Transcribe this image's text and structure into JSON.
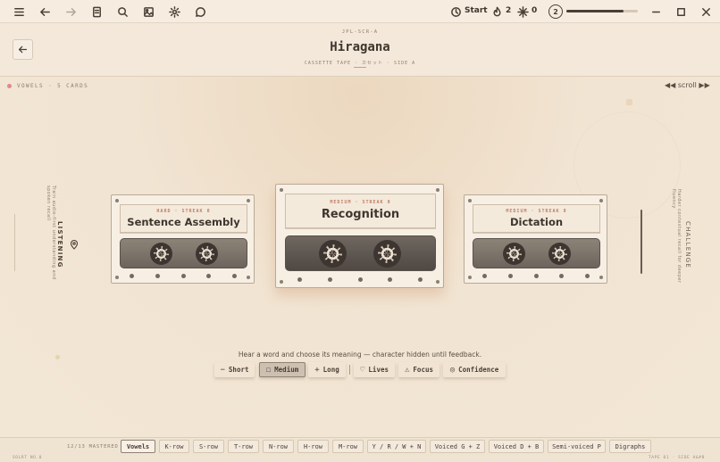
{
  "topbar": {
    "icons": [
      "menu-icon",
      "back-arrow-icon",
      "forward-arrow-icon",
      "notebook-icon",
      "search-icon",
      "image-icon",
      "gear-icon",
      "chat-icon"
    ],
    "start_label": "Start",
    "streak_count": "2",
    "gems_count": "0",
    "level_badge": "2",
    "progress": 0.8,
    "window_controls": [
      "minimize-icon",
      "maximize-icon",
      "close-icon"
    ]
  },
  "header": {
    "kicker": "JPL-SCR-A",
    "title": "Hiragana",
    "subtitle": "CASSETTE TAPE · カセット · SIDE A"
  },
  "stage": {
    "deck_label": "VOWELS · 5 CARDS",
    "scroll_label": "◀◀ scroll ▶▶",
    "left_side": {
      "title": "LISTENING",
      "caption": "Train audio-first understanding and spoken recall"
    },
    "right_side": {
      "title": "CHALLENGE",
      "caption": "Harder contextual recall for deeper fluency"
    }
  },
  "cassettes": [
    {
      "kicker": "HARD · STREAK 0",
      "title": "Sentence Assembly"
    },
    {
      "kicker": "MEDIUM · STREAK 0",
      "title": "Recognition"
    },
    {
      "kicker": "MEDIUM · STREAK 0",
      "title": "Dictation"
    }
  ],
  "hint": "Hear a word and choose its meaning — character hidden until feedback.",
  "modes": [
    {
      "icon": "−",
      "label": "Short"
    },
    {
      "icon": "☐",
      "label": "Medium"
    },
    {
      "icon": "+",
      "label": "Long"
    },
    {
      "icon": "♡",
      "label": "Lives"
    },
    {
      "icon": "⚠",
      "label": "Focus"
    },
    {
      "icon": "◎",
      "label": "Confidence"
    }
  ],
  "bottom": {
    "mastered": "12/13 MASTERED",
    "tabs": [
      "Vowels",
      "K-row",
      "S-row",
      "T-row",
      "N-row",
      "H-row",
      "M-row",
      "Y / R / W + N",
      "Voiced G + Z",
      "Voiced D + B",
      "Semi-voiced P",
      "Digraphs"
    ],
    "active_tab": 0,
    "footer_left": "SOLRT NO.0",
    "footer_right": "TAPE 01 · SIDE A&#B"
  },
  "colors": {
    "background": "#f1e4d2",
    "accent": "#c07d67",
    "ink": "#4a3f36"
  }
}
